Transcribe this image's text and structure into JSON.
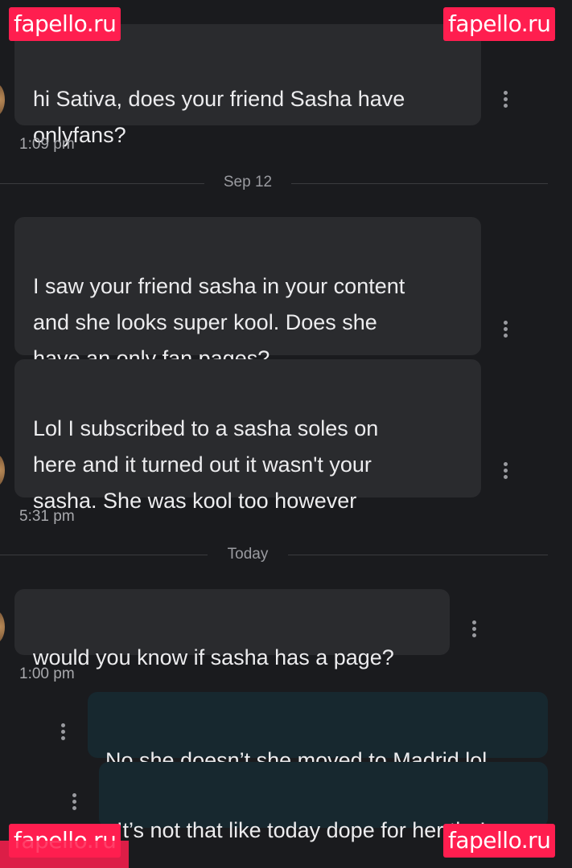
{
  "watermark": {
    "text": "fapello.ru"
  },
  "messages": [
    {
      "text": "hi Sativa, does your friend Sasha have\nonlyfans?"
    },
    {
      "text": "I saw your friend sasha in your content\nand she looks super kool. Does she\nhave an only fan pages?"
    },
    {
      "text": "Lol I subscribed to a sasha soles on\nhere and it turned out it wasn't your\nsasha. She was kool too however"
    },
    {
      "text": "would you know if sasha has a page?"
    },
    {
      "text": "No she doesn’t she moved to Madrid lol"
    },
    {
      "text": "It’s not that like today dope for her tho!"
    }
  ],
  "timestamps": [
    "1:09 pm",
    "5:31 pm",
    "1:00 pm"
  ],
  "date_separators": [
    "Sep 12",
    "Today"
  ],
  "colors": {
    "background": "#1a1b1e",
    "incoming_bubble": "#2a2b2e",
    "outgoing_bubble": "#17282f",
    "watermark": "#ff1e4f"
  }
}
